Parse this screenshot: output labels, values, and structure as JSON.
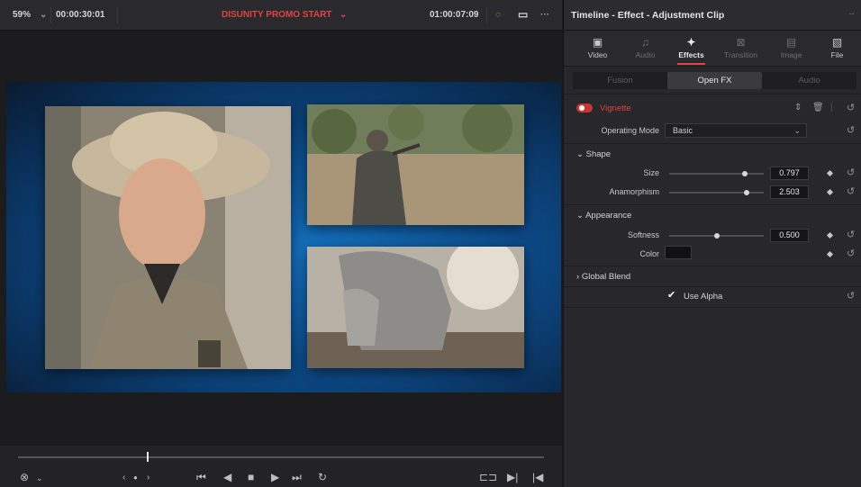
{
  "viewer": {
    "zoom": "59%",
    "timecode_left": "00:00:30:01",
    "title": "DISUNITY PROMO START",
    "timecode_right": "01:00:07:09"
  },
  "inspector": {
    "title": "Timeline - Effect - Adjustment Clip",
    "tabs": [
      "Video",
      "Audio",
      "Effects",
      "Transition",
      "Image",
      "File"
    ],
    "active_tab": "Effects",
    "subtabs": [
      "Fusion",
      "Open FX",
      "Audio"
    ],
    "active_subtab": "Open FX",
    "effect_name": "Vignette",
    "operating_mode_label": "Operating Mode",
    "operating_mode_value": "Basic",
    "shape_label": "Shape",
    "size_label": "Size",
    "size_value": "0.797",
    "size_fraction": 0.797,
    "anamorphism_label": "Anamorphism",
    "anamorphism_value": "2.503",
    "appearance_label": "Appearance",
    "softness_label": "Softness",
    "softness_value": "0.500",
    "softness_fraction": 0.5,
    "color_label": "Color",
    "color_value": "#111112",
    "global_blend_label": "Global Blend",
    "use_alpha_label": "Use Alpha",
    "use_alpha_checked": true
  },
  "colors": {
    "accent": "#e0443f",
    "canvas_blue": "#1573c2"
  }
}
